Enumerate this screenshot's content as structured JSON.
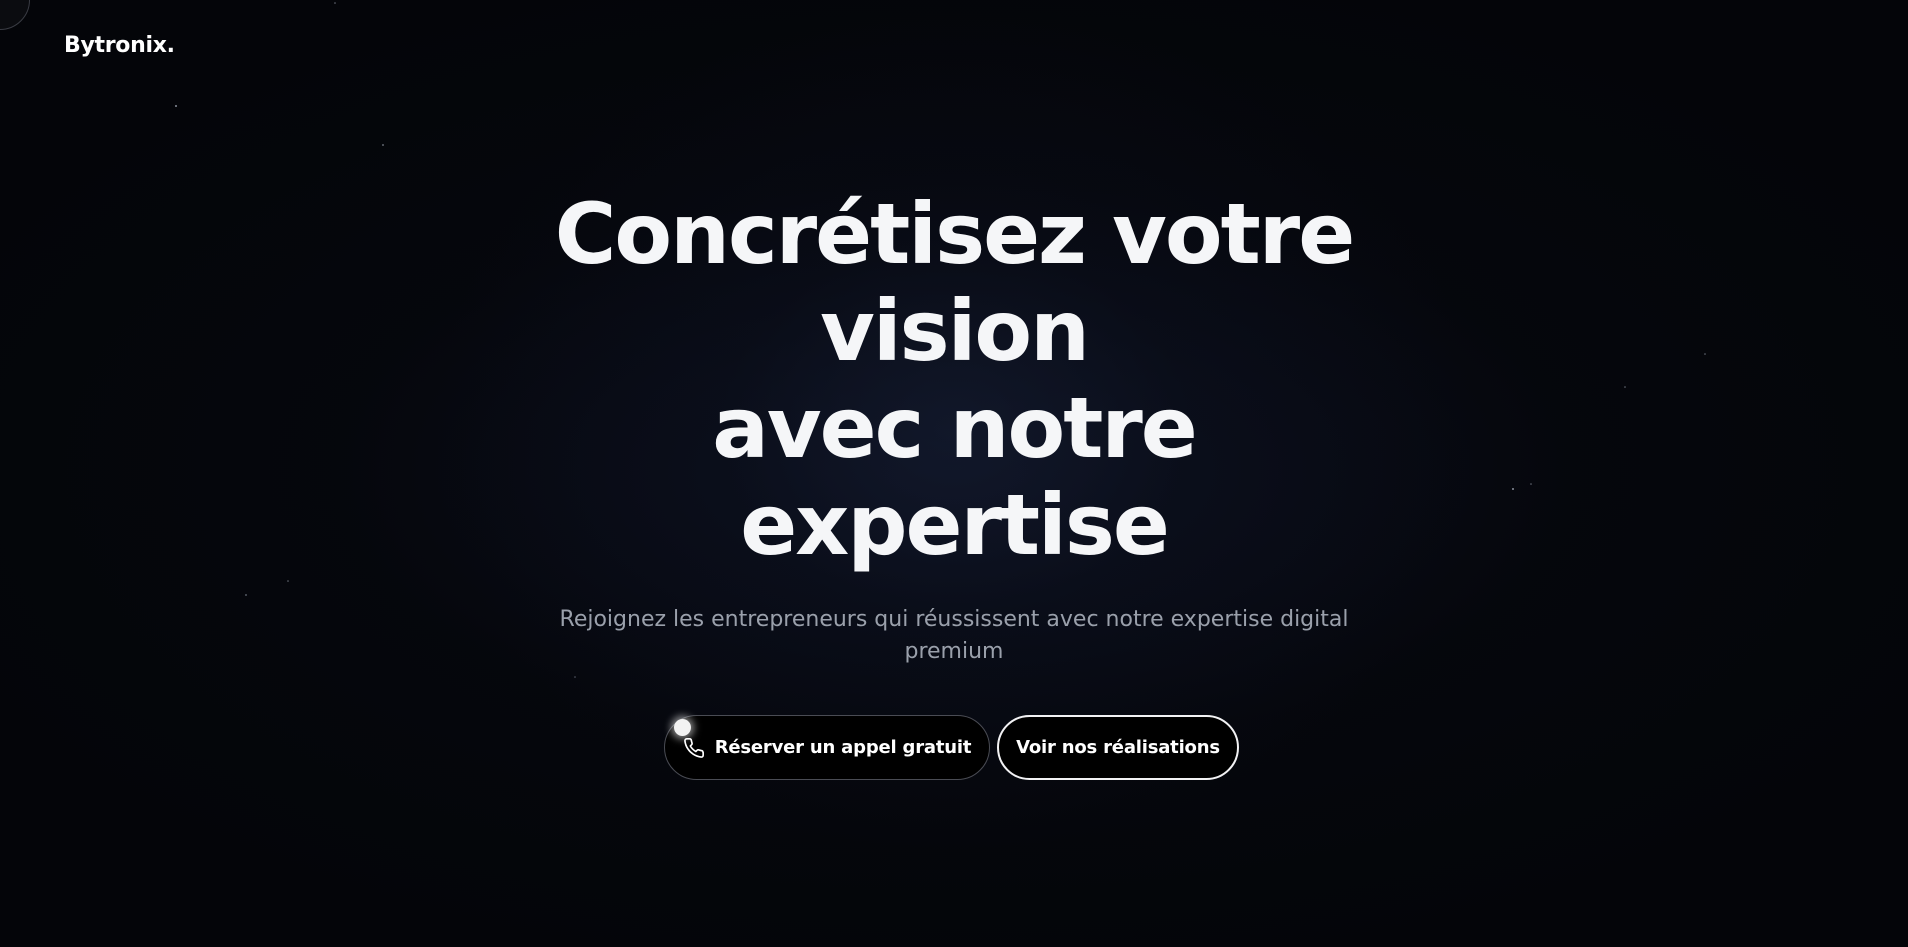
{
  "brand": {
    "logo_text": "Bytronix."
  },
  "hero": {
    "title_lines": [
      "Concrétisez votre",
      "vision",
      "avec notre",
      "expertise"
    ],
    "subtitle_lines": [
      "Rejoignez les entrepreneurs qui réussissent avec notre expertise digital",
      "premium"
    ]
  },
  "cta": {
    "primary_label": "Réserver un appel gratuit",
    "primary_icon": "phone-icon",
    "secondary_label": "Voir nos réalisations"
  },
  "colors": {
    "background": "#040509",
    "text": "#ffffff",
    "subtitle": "#9aa0ab"
  }
}
